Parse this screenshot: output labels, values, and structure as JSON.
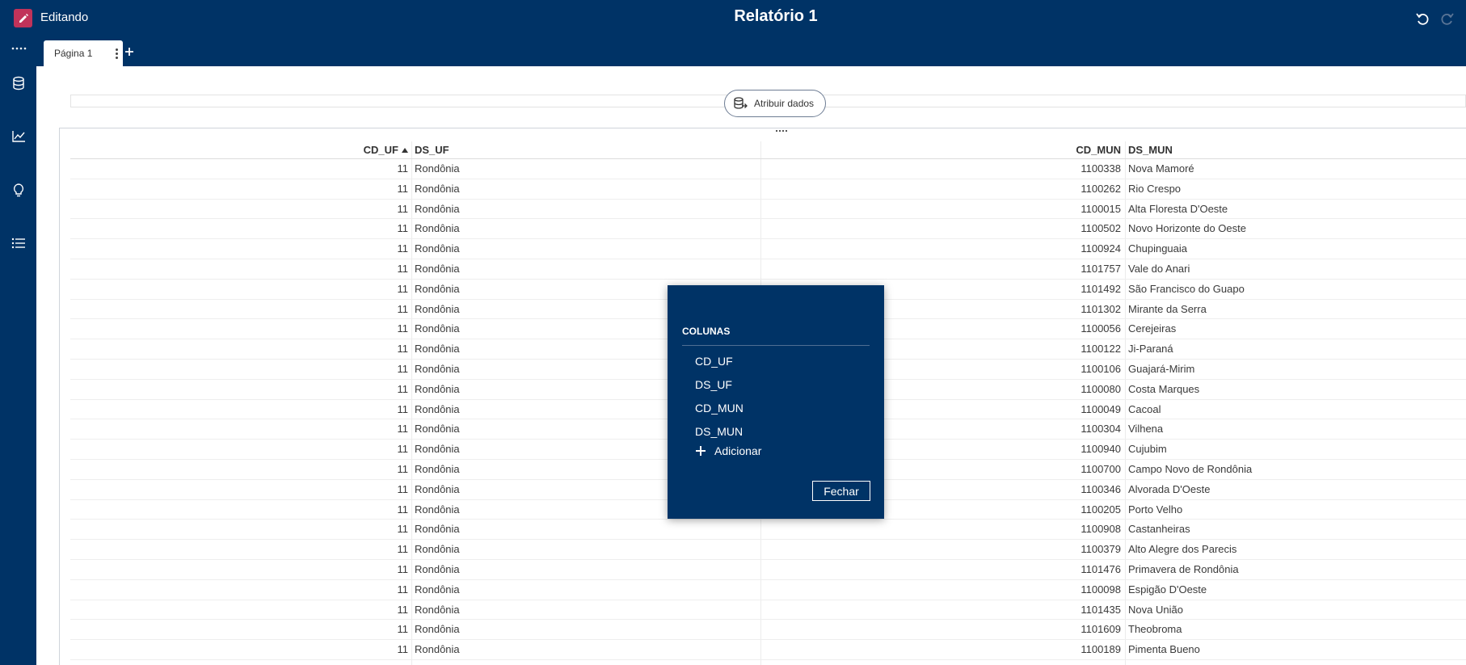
{
  "header": {
    "mode_label": "Editando",
    "title": "Relatório 1",
    "undo_icon": "undo-icon",
    "redo_icon": "redo-icon"
  },
  "left_rail": {
    "items": [
      {
        "icon": "more-dots-icon"
      },
      {
        "icon": "database-icon"
      },
      {
        "icon": "chart-line-icon"
      },
      {
        "icon": "lightbulb-icon"
      },
      {
        "icon": "list-icon"
      }
    ]
  },
  "tabs": {
    "pages": [
      {
        "label": "Página 1"
      }
    ],
    "add_icon": "plus-icon"
  },
  "canvas": {
    "assign_data_label": "Atribuir dados"
  },
  "table": {
    "columns": [
      "CD_UF",
      "DS_UF",
      "CD_MUN",
      "DS_MUN"
    ],
    "sorted_column": "CD_UF",
    "sort_direction": "ascending",
    "rows": [
      [
        "11",
        "Rondônia",
        "1100338",
        "Nova Mamoré"
      ],
      [
        "11",
        "Rondônia",
        "1100262",
        "Rio Crespo"
      ],
      [
        "11",
        "Rondônia",
        "1100015",
        "Alta Floresta D'Oeste"
      ],
      [
        "11",
        "Rondônia",
        "1100502",
        "Novo Horizonte do Oeste"
      ],
      [
        "11",
        "Rondônia",
        "1100924",
        "Chupinguaia"
      ],
      [
        "11",
        "Rondônia",
        "1101757",
        "Vale do Anari"
      ],
      [
        "11",
        "Rondônia",
        "1101492",
        "São Francisco do Guapo"
      ],
      [
        "11",
        "Rondônia",
        "1101302",
        "Mirante da Serra"
      ],
      [
        "11",
        "Rondônia",
        "1100056",
        "Cerejeiras"
      ],
      [
        "11",
        "Rondônia",
        "1100122",
        "Ji-Paraná"
      ],
      [
        "11",
        "Rondônia",
        "1100106",
        "Guajará-Mirim"
      ],
      [
        "11",
        "Rondônia",
        "1100080",
        "Costa Marques"
      ],
      [
        "11",
        "Rondônia",
        "1100049",
        "Cacoal"
      ],
      [
        "11",
        "Rondônia",
        "1100304",
        "Vilhena"
      ],
      [
        "11",
        "Rondônia",
        "1100940",
        "Cujubim"
      ],
      [
        "11",
        "Rondônia",
        "1100700",
        "Campo Novo de Rondônia"
      ],
      [
        "11",
        "Rondônia",
        "1100346",
        "Alvorada D'Oeste"
      ],
      [
        "11",
        "Rondônia",
        "1100205",
        "Porto Velho"
      ],
      [
        "11",
        "Rondônia",
        "1100908",
        "Castanheiras"
      ],
      [
        "11",
        "Rondônia",
        "1100379",
        "Alto Alegre dos Parecis"
      ],
      [
        "11",
        "Rondônia",
        "1101476",
        "Primavera de Rondônia"
      ],
      [
        "11",
        "Rondônia",
        "1100098",
        "Espigão D'Oeste"
      ],
      [
        "11",
        "Rondônia",
        "1101435",
        "Nova União"
      ],
      [
        "11",
        "Rondônia",
        "1101609",
        "Theobroma"
      ],
      [
        "11",
        "Rondônia",
        "1100189",
        "Pimenta Bueno"
      ]
    ]
  },
  "popup": {
    "section_label": "COLUNAS",
    "items": [
      "CD_UF",
      "DS_UF",
      "CD_MUN",
      "DS_MUN"
    ],
    "add_label": "Adicionar",
    "close_label": "Fechar"
  },
  "colors": {
    "brand_navy": "#003366",
    "edit_accent": "#c1335a"
  }
}
